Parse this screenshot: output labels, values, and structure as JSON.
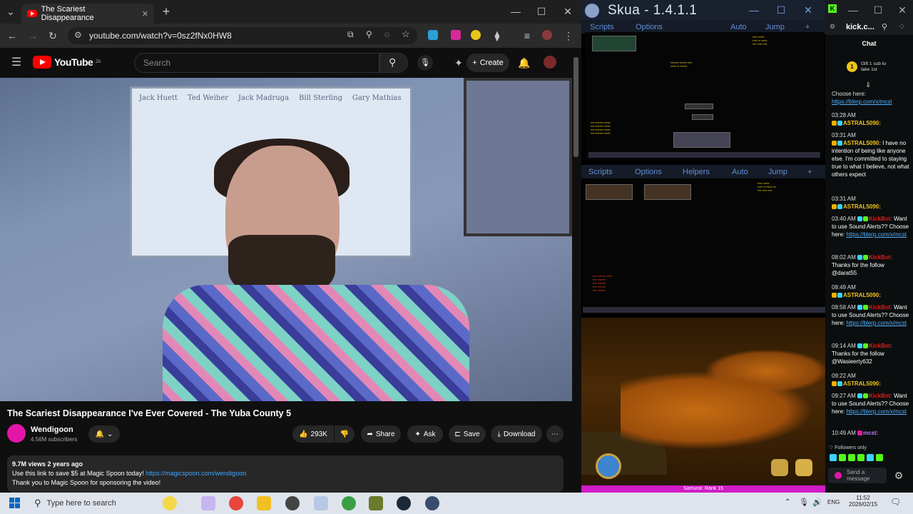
{
  "chrome": {
    "tab_title": "The Scariest Disappearance",
    "url": "youtube.com/watch?v=0sz2fNx0HW8"
  },
  "youtube": {
    "logo": "YouTube",
    "logo_region": "ZA",
    "search_placeholder": "Search",
    "create_label": "Create",
    "video_title": "The Scariest Disappearance I've Ever Covered - The Yuba County 5",
    "channel_name": "Wendigoon",
    "subscribers": "4.56M subscribers",
    "likes": "293K",
    "share_label": "Share",
    "ask_label": "Ask",
    "save_label": "Save",
    "download_label": "Download",
    "views_line": "9.7M views  2 years ago",
    "desc_line1": "Use this link to save $5 at Magic Spoon today!",
    "desc_link": "https://magicspoon.com/wendigoon",
    "desc_line2": "Thank you to Magic Spoon for sponsoring the video!",
    "whiteboard_names": [
      "Jack Huett",
      "Ted Weiher",
      "Jack Madruga",
      "Bill Sterling",
      "Gary Mathias"
    ]
  },
  "skua": {
    "title": "Skua - 1.4.1.1",
    "menu_top": [
      "Scripts",
      "Options",
      "Auto",
      "Jump",
      "+"
    ],
    "menu_mid": [
      "Scripts",
      "Options",
      "Helpers",
      "Auto",
      "Jump",
      "+"
    ],
    "rank_text": "Samurai: Rank 15"
  },
  "kick": {
    "tab_title": "kick.c...",
    "chat_label": "Chat",
    "gift_text": "Gift 1 sub to take 1st",
    "messages": [
      {
        "time": "",
        "user": "",
        "text": "Choose here:",
        "link": "https://blerp.com/x/mcst"
      },
      {
        "time": "03:28 AM",
        "user": "ASTRAL5090:",
        "text": "",
        "link": ""
      },
      {
        "time": "03:31 AM",
        "user": "ASTRAL5090:",
        "text": "I have no intention of being like anyone else. I'm committed to staying true to what I believe, not what others expect",
        "link": ""
      },
      {
        "time": "03:31 AM",
        "user": "ASTRAL5090:",
        "text": "",
        "link": ""
      },
      {
        "time": "03:40 AM",
        "user": "KickBot:",
        "text": "Want to use Sound Alerts?? Choose here:",
        "link": "https://blerp.com/x/mcst"
      },
      {
        "time": "08:02 AM",
        "user": "KickBot:",
        "text": "Thanks for the follow @darat55",
        "link": ""
      },
      {
        "time": "08:49 AM",
        "user": "ASTRAL5090:",
        "text": "",
        "link": ""
      },
      {
        "time": "08:58 AM",
        "user": "KickBot:",
        "text": "Want to use Sound Alerts?? Choose here:",
        "link": "https://blerp.com/x/mcst"
      },
      {
        "time": "09:14 AM",
        "user": "KickBot:",
        "text": "Thanks for the follow @Wasieerty632",
        "link": ""
      },
      {
        "time": "09:22 AM",
        "user": "ASTRAL5090:",
        "text": "",
        "link": ""
      },
      {
        "time": "09:27 AM",
        "user": "KickBot:",
        "text": "Want to use Sound Alerts?? Choose here:",
        "link": "https://blerp.com/x/mcst"
      },
      {
        "time": "10:49 AM",
        "user": "mcst:",
        "text": "",
        "link": ""
      }
    ],
    "followers_only": "Followers only",
    "send_placeholder": "Send a message"
  },
  "taskbar": {
    "search_placeholder": "Type here to search",
    "lang": "ENG",
    "time": "11:52",
    "date": "2026/02/15"
  }
}
